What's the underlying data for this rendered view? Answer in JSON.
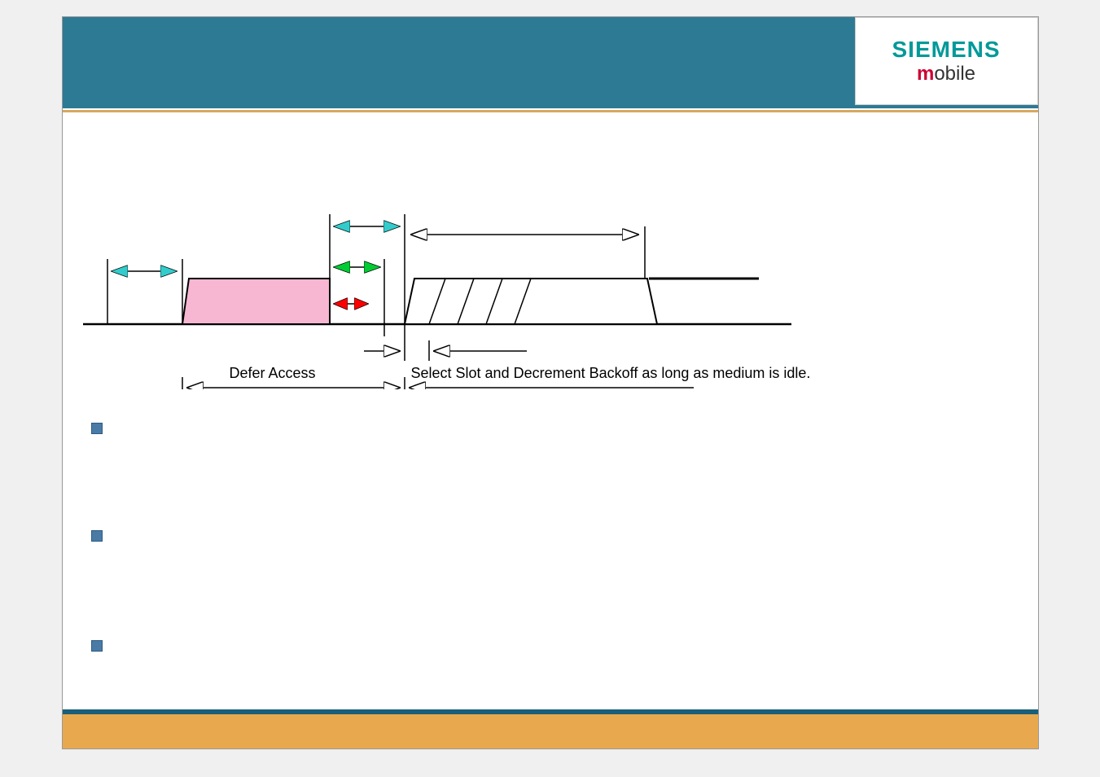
{
  "logo": {
    "brand": "SIEMENS",
    "sub_m": "m",
    "sub_rest": "obile"
  },
  "diagram": {
    "defer_label": "Defer Access",
    "select_label": "Select Slot and Decrement Backoff as long as medium is idle."
  },
  "colors": {
    "header": "#2d7a95",
    "footer": "#e8a84e",
    "busy_block": "#f7b6d2",
    "arrow_cyan": "#33cccc",
    "arrow_green": "#00cc33",
    "arrow_red": "#ff0000"
  }
}
